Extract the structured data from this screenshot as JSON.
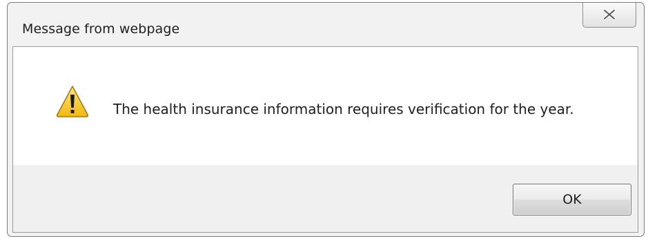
{
  "dialog": {
    "title": "Message from webpage",
    "close_icon": "close-icon",
    "icon": "warning-icon",
    "message": "The health insurance information requires verification for the year.",
    "ok_label": "OK"
  },
  "colors": {
    "frame": "#f2f2f2",
    "message_background": "#ffffff",
    "button_area": "#f0f0f0",
    "warning_yellow": "#f5c818"
  }
}
